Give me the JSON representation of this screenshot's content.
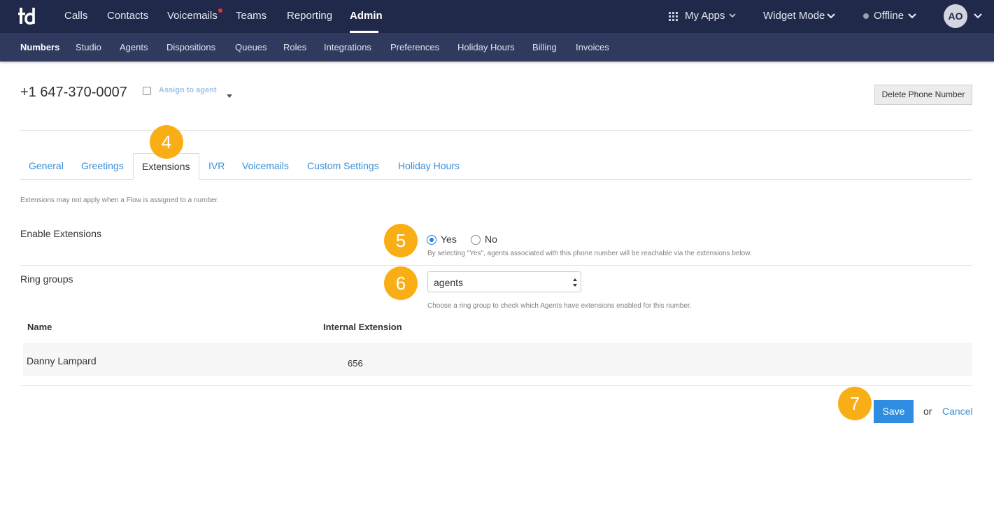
{
  "topnav": {
    "logo_icon": "td-logo",
    "items": [
      "Calls",
      "Contacts",
      "Voicemails",
      "Teams",
      "Reporting",
      "Admin"
    ],
    "active": "Admin",
    "my_apps": "My Apps",
    "widget_mode": "Widget Mode",
    "status": "Offline",
    "avatar_initials": "AO"
  },
  "subnav": {
    "items": [
      "Numbers",
      "Studio",
      "Agents",
      "Dispositions",
      "Queues",
      "Roles",
      "Integrations",
      "Preferences",
      "Holiday Hours",
      "Billing",
      "Invoices"
    ],
    "active": "Numbers"
  },
  "header": {
    "phone_number": "+1 647-370-0007",
    "assign_to_agent": "Assign to agent",
    "delete_button": "Delete Phone Number"
  },
  "tabs": {
    "items": [
      "General",
      "Greetings",
      "Extensions",
      "IVR",
      "Voicemails",
      "Custom Settings",
      "Holiday Hours"
    ],
    "active": "Extensions"
  },
  "steps": [
    "4",
    "5",
    "6",
    "7"
  ],
  "extensions": {
    "note": "Extensions may not apply when a Flow is assigned to a number.",
    "enable_label": "Enable Extensions",
    "yes_label": "Yes",
    "no_label": "No",
    "selected": "Yes",
    "enable_hint": "By selecting \"Yes\", agents associated with this phone number will be reachable via the extensions below.",
    "ring_groups_label": "Ring groups",
    "ring_group_value": "agents",
    "ring_group_hint": "Choose a ring group to check which Agents have extensions enabled for this number.",
    "table": {
      "headers": [
        "Name",
        "Internal Extension"
      ],
      "rows": [
        [
          "Danny Lampard",
          "656"
        ]
      ]
    }
  },
  "footer": {
    "save": "Save",
    "or": "or",
    "cancel": "Cancel"
  },
  "colors": {
    "topbar": "#202949",
    "subbar": "#2f3a5e",
    "accent": "#2e8de0",
    "badge": "#f9ae16",
    "notification": "#e8313a"
  }
}
